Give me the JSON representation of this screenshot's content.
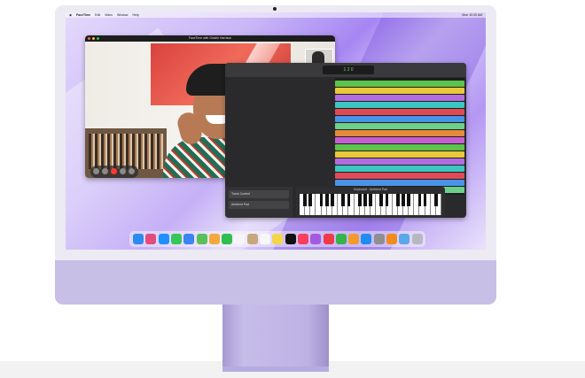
{
  "menubar": {
    "app_name": "FaceTime",
    "items": [
      "Edit",
      "Video",
      "Window",
      "Help"
    ],
    "right_status": "Mon 10:00 AM"
  },
  "facetime": {
    "window_title": "FaceTime with Giselle Harrison",
    "controls": [
      "sidebar-icon",
      "mute-icon",
      "end-call-icon",
      "camera-icon",
      "fullscreen-icon"
    ]
  },
  "garageband": {
    "lcd": "1 2 0",
    "track_headers": [
      "Track Control",
      "Ambient Pad"
    ],
    "keyboard_title": "Keyboard - Ambient Pad",
    "track_colors": [
      "#5ec34b",
      "#e9c83a",
      "#b36cdf",
      "#3cc6c0",
      "#e04a55",
      "#4a93e6",
      "#6cd08a",
      "#e38b3c",
      "#c65ed2"
    ]
  },
  "dock": {
    "icons": [
      "finder-icon",
      "launchpad-icon",
      "safari-icon",
      "messages-icon",
      "mail-icon",
      "maps-icon",
      "photos-icon",
      "facetime-icon",
      "calendar-icon",
      "contacts-icon",
      "reminders-icon",
      "notes-icon",
      "appletv-icon",
      "music-icon",
      "podcasts-icon",
      "news-icon",
      "numbers-icon",
      "pages-icon",
      "appstore-icon",
      "settings-icon",
      "garageband-icon",
      "folder-icon",
      "trash-icon"
    ],
    "colors": [
      "#2c8cf2",
      "#e24d7f",
      "#1e90ff",
      "#34c759",
      "#3a85f0",
      "#5ac05a",
      "#f2a93b",
      "#2fbf4e",
      "#f5f5f5",
      "#c7a77c",
      "#f7f7f7",
      "#f4d64a",
      "#111111",
      "#fa3e5c",
      "#a45ae0",
      "#ee3b47",
      "#35b34a",
      "#f19b2c",
      "#1f8cf0",
      "#8e8e93",
      "#f28a1c",
      "#5aa7ea",
      "#b8b8c0"
    ]
  }
}
